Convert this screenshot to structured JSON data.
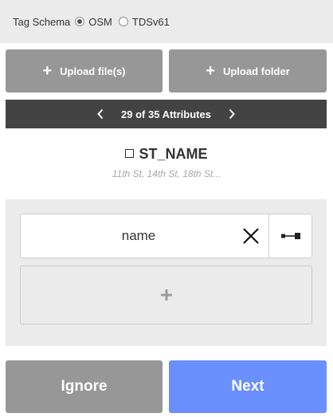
{
  "schema": {
    "label": "Tag Schema",
    "options": [
      {
        "label": "OSM",
        "selected": true
      },
      {
        "label": "TDSv61",
        "selected": false
      }
    ]
  },
  "upload": {
    "files_label": "Upload file(s)",
    "folder_label": "Upload folder",
    "plus_icon": "plus-icon"
  },
  "nav": {
    "counter": "29 of 35 Attributes",
    "prev_icon": "chevron-left-icon",
    "next_icon": "chevron-right-icon"
  },
  "attribute": {
    "name": "ST_NAME",
    "checkbox_icon": "checkbox-icon",
    "sample_values": "11th St, 14th St, 18th St..."
  },
  "mapping": {
    "tag_value": "name",
    "clear_icon": "close-icon",
    "link_icon": "link-toggle-icon",
    "add_icon": "plus-icon"
  },
  "actions": {
    "ignore_label": "Ignore",
    "next_label": "Next"
  },
  "colors": {
    "next": "#6a8ffe",
    "ignore": "#979797",
    "nav_bar": "#434343",
    "panel": "#ebebeb"
  }
}
